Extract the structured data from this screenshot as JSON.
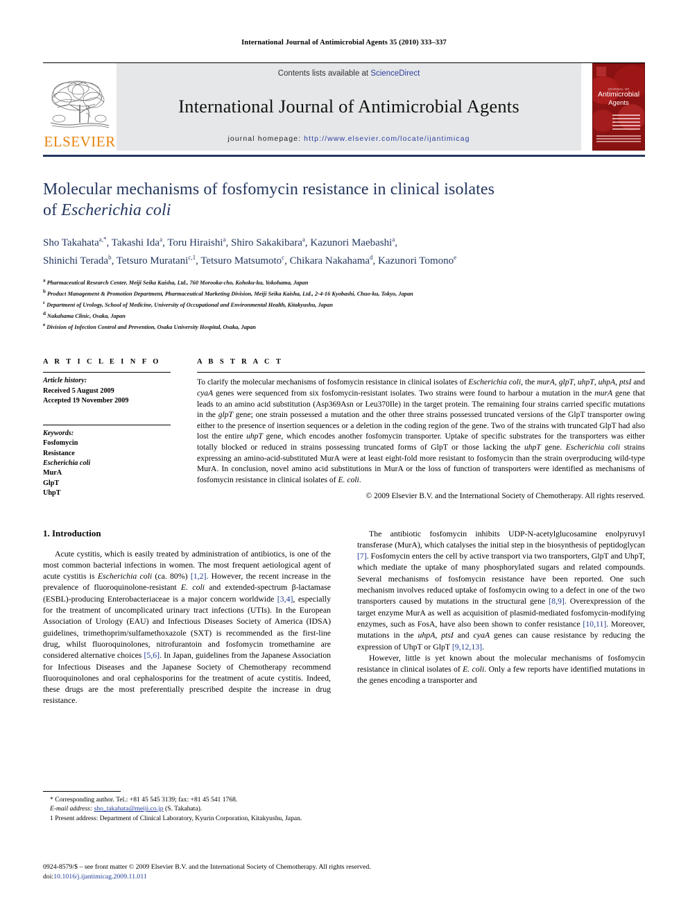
{
  "running_head": "International Journal of Antimicrobial Agents 35 (2010) 333–337",
  "masthead": {
    "publisher_logo_text": "ELSEVIER",
    "contents_prefix": "Contents lists available at ",
    "contents_link": "ScienceDirect",
    "journal_title": "International Journal of Antimicrobial Agents",
    "homepage_prefix": "journal homepage: ",
    "homepage_url": "http://www.elsevier.com/locate/ijantimicag",
    "cover": {
      "kicker": "JOURNAL OF",
      "line1": "Antimicrobial",
      "line2": "Agents"
    }
  },
  "article": {
    "title_line1": "Molecular mechanisms of fosfomycin resistance in clinical isolates",
    "title_line2_prefix": "of ",
    "title_line2_italic": "Escherichia coli",
    "authors_line1": "Sho Takahata a,*, Takashi Ida a, Toru Hiraishi a, Shiro Sakakibara a, Kazunori Maebashi a,",
    "authors_line2": "Shinichi Terada b, Tetsuro Muratani c,1, Tetsuro Matsumoto c, Chikara Nakahama d, Kazunori Tomono e",
    "authors": [
      {
        "name": "Sho Takahata",
        "sup": "a,*"
      },
      {
        "name": "Takashi Ida",
        "sup": "a"
      },
      {
        "name": "Toru Hiraishi",
        "sup": "a"
      },
      {
        "name": "Shiro Sakakibara",
        "sup": "a"
      },
      {
        "name": "Kazunori Maebashi",
        "sup": "a"
      },
      {
        "name": "Shinichi Terada",
        "sup": "b"
      },
      {
        "name": "Tetsuro Muratani",
        "sup": "c,1"
      },
      {
        "name": "Tetsuro Matsumoto",
        "sup": "c"
      },
      {
        "name": "Chikara Nakahama",
        "sup": "d"
      },
      {
        "name": "Kazunori Tomono",
        "sup": "e"
      }
    ],
    "affiliations": [
      {
        "mark": "a",
        "text": "Pharmaceutical Research Center, Meiji Seika Kaisha, Ltd., 760 Morooka-cho, Kohoku-ku, Yokohama, Japan"
      },
      {
        "mark": "b",
        "text": "Product Management & Promotion Department, Pharmaceutical Marketing Division, Meiji Seika Kaisha, Ltd., 2-4-16 Kyobashi, Chuo-ku, Tokyo, Japan"
      },
      {
        "mark": "c",
        "text": "Department of Urology, School of Medicine, University of Occupational and Environmental Health, Kitakyushu, Japan"
      },
      {
        "mark": "d",
        "text": "Nakahama Clinic, Osaka, Japan"
      },
      {
        "mark": "e",
        "text": "Division of Infection Control and Prevention, Osaka University Hospital, Osaka, Japan"
      }
    ]
  },
  "article_info": {
    "heading": "A R T I C L E  I N F O",
    "history_label": "Article history:",
    "received": "Received 5 August 2009",
    "accepted": "Accepted 19 November 2009",
    "keywords_label": "Keywords:",
    "keywords": [
      "Fosfomycin",
      "Resistance",
      "Escherichia coli",
      "MurA",
      "GlpT",
      "UhpT"
    ]
  },
  "abstract": {
    "heading": "A B S T R A C T",
    "text": "To clarify the molecular mechanisms of fosfomycin resistance in clinical isolates of Escherichia coli, the murA, glpT, uhpT, uhpA, ptsI and cyaA genes were sequenced from six fosfomycin-resistant isolates. Two strains were found to harbour a mutation in the murA gene that leads to an amino acid substitution (Asp369Asn or Leu370Ile) in the target protein. The remaining four strains carried specific mutations in the glpT gene; one strain possessed a mutation and the other three strains possessed truncated versions of the GlpT transporter owing either to the presence of insertion sequences or a deletion in the coding region of the gene. Two of the strains with truncated GlpT had also lost the entire uhpT gene, which encodes another fosfomycin transporter. Uptake of specific substrates for the transporters was either totally blocked or reduced in strains possessing truncated forms of GlpT or those lacking the uhpT gene. Escherichia coli strains expressing an amino-acid-substituted MurA were at least eight-fold more resistant to fosfomycin than the strain overproducing wild-type MurA. In conclusion, novel amino acid substitutions in MurA or the loss of function of transporters were identified as mechanisms of fosfomycin resistance in clinical isolates of E. coli.",
    "copyright": "© 2009 Elsevier B.V. and the International Society of Chemotherapy. All rights reserved."
  },
  "intro": {
    "heading": "1.  Introduction",
    "para1": "Acute cystitis, which is easily treated by administration of antibiotics, is one of the most common bacterial infections in women. The most frequent aetiological agent of acute cystitis is Escherichia coli (ca. 80%) [1,2]. However, the recent increase in the prevalence of fluoroquinolone-resistant E. coli and extended-spectrum β-lactamase (ESBL)-producing Enterobacteriaceae is a major concern worldwide [3,4], especially for the treatment of uncomplicated urinary tract infections (UTIs). In the European Association of Urology (EAU) and Infectious Diseases Society of America (IDSA) guidelines, trimethoprim/sulfamethoxazole (SXT) is recommended as the first-line drug, whilst fluoroquinolones, nitrofurantoin and fosfomycin tromethamine are considered alternative choices [5,6]. In Japan, guidelines from the Japanese Association for Infectious Diseases and the Japanese Society of Chemotherapy recommend fluoroquinolones and oral cephalosporins for the treatment of acute cystitis. Indeed, these drugs are the most preferentially prescribed despite the increase in drug resistance.",
    "para2": "The antibiotic fosfomycin inhibits UDP-N-acetylglucosamine enolpyruvyl transferase (MurA), which catalyses the initial step in the biosynthesis of peptidoglycan [7]. Fosfomycin enters the cell by active transport via two transporters, GlpT and UhpT, which mediate the uptake of many phosphorylated sugars and related compounds. Several mechanisms of fosfomycin resistance have been reported. One such mechanism involves reduced uptake of fosfomycin owing to a defect in one of the two transporters caused by mutations in the structural gene [8,9]. Overexpression of the target enzyme MurA as well as acquisition of plasmid-mediated fosfomycin-modifying enzymes, such as FosA, have also been shown to confer resistance [10,11]. Moreover, mutations in the uhpA, ptsI and cyaA genes can cause resistance by reducing the expression of UhpT or GlpT [9,12,13].",
    "para3": "However, little is yet known about the molecular mechanisms of fosfomycin resistance in clinical isolates of E. coli. Only a few reports have identified mutations in the genes encoding a transporter and"
  },
  "footnotes": {
    "corresponding": "* Corresponding author. Tel.: +81 45 545 3139; fax: +81 45 541 1768.",
    "email_label": "E-mail address:",
    "email": "sho_takahata@meiji.co.jp",
    "email_suffix": "(S. Takahata).",
    "present_address": "1 Present address: Department of Clinical Laboratory, Kyurin Corporation, Kitakyushu, Japan."
  },
  "issn_block": {
    "line1": "0924-8579/$ – see front matter © 2009 Elsevier B.V. and the International Society of Chemotherapy. All rights reserved.",
    "doi_label": "doi:",
    "doi": "10.1016/j.ijantimicag.2009.11.011"
  },
  "colors": {
    "heading_blue": "#23365E",
    "link_blue": "#1F3A93",
    "elsevier_orange": "#E8820C",
    "masthead_gray": "#E6E7E8",
    "cover_red": "#8B1212"
  }
}
